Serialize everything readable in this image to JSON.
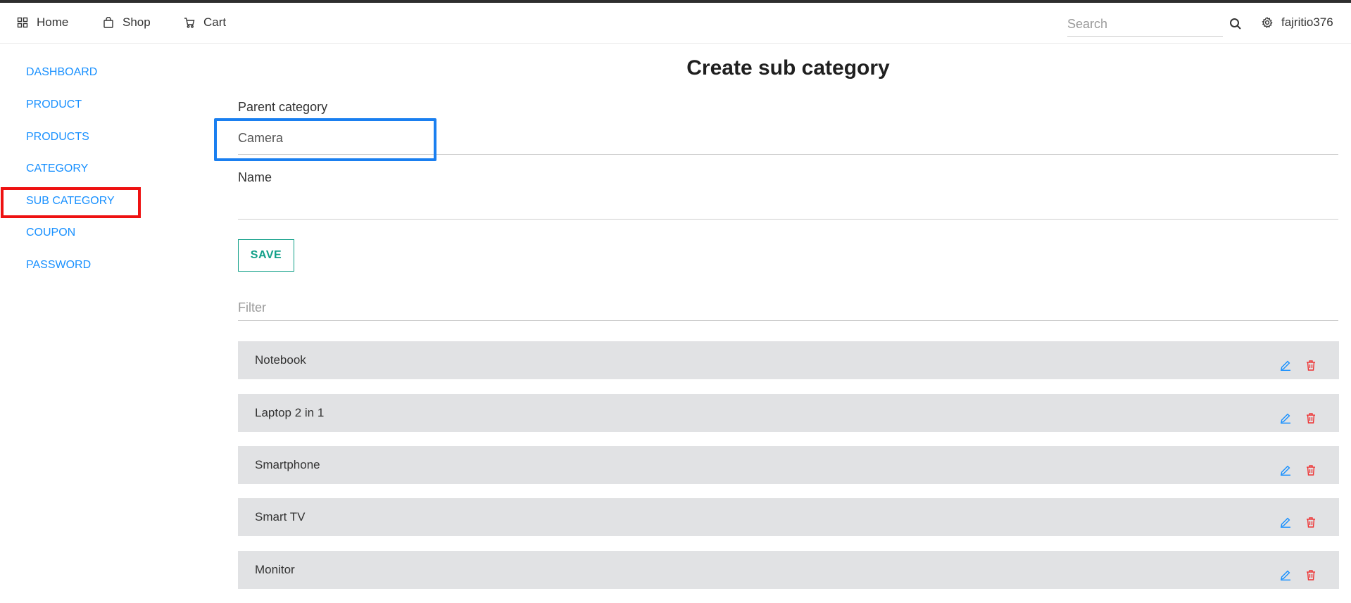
{
  "navbar": {
    "home_label": "Home",
    "shop_label": "Shop",
    "cart_label": "Cart",
    "search_placeholder": "Search",
    "username": "fajritio376",
    "icons": [
      "grid-icon",
      "bag-icon",
      "cart-icon",
      "search-icon",
      "gear-icon"
    ]
  },
  "sidebar": {
    "items": [
      {
        "label": "DASHBOARD"
      },
      {
        "label": "PRODUCT"
      },
      {
        "label": "PRODUCTS"
      },
      {
        "label": "CATEGORY"
      },
      {
        "label": "SUB CATEGORY"
      },
      {
        "label": "COUPON"
      },
      {
        "label": "PASSWORD"
      }
    ],
    "active_highlight_color": "#ee1111"
  },
  "main": {
    "title": "Create sub category",
    "parent_category_label": "Parent category",
    "parent_category_value": "Camera",
    "parent_highlight_color": "#1a7ff0",
    "name_label": "Name",
    "name_value": "",
    "save_label": "SAVE",
    "filter_placeholder": "Filter",
    "accent_color": "#12a089",
    "subcategories": [
      {
        "label": "Notebook"
      },
      {
        "label": "Laptop 2 in 1"
      },
      {
        "label": "Smartphone"
      },
      {
        "label": "Smart TV"
      },
      {
        "label": "Monitor"
      }
    ]
  }
}
